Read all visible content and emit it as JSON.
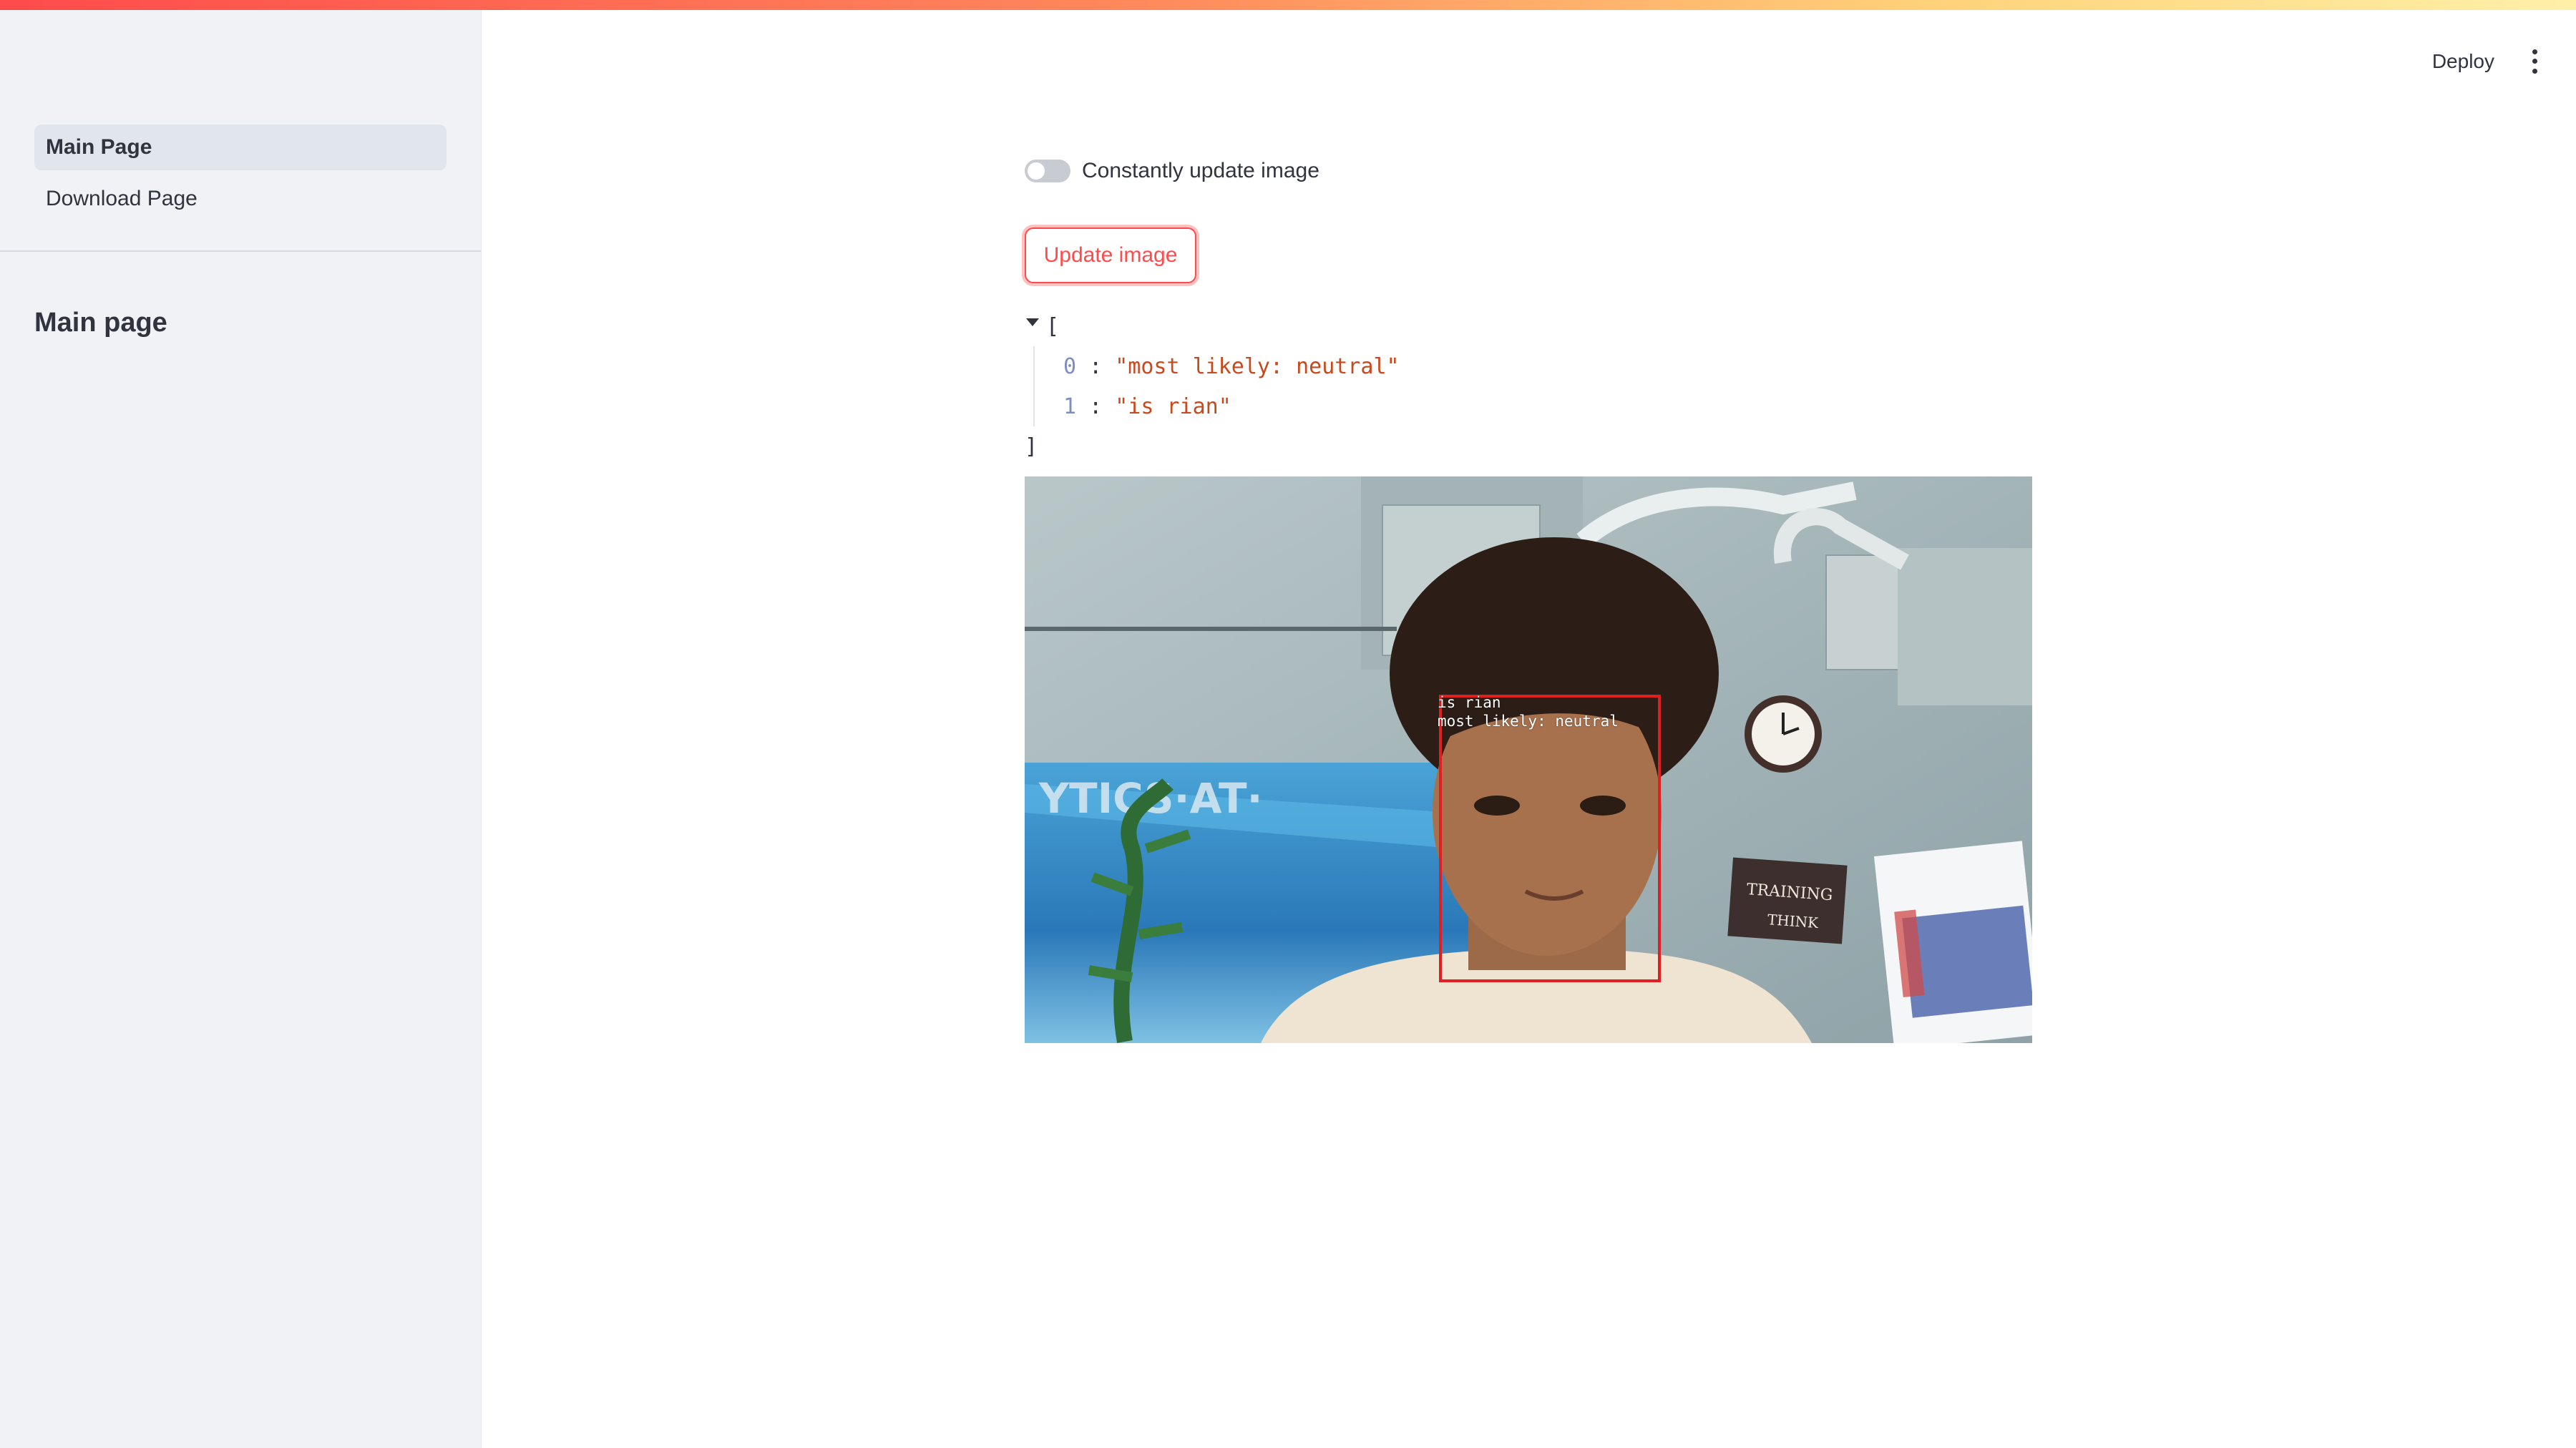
{
  "sidebar": {
    "nav_items": [
      {
        "label": "Main Page",
        "active": true
      },
      {
        "label": "Download Page",
        "active": false
      }
    ],
    "section_title": "Main page"
  },
  "header": {
    "deploy_label": "Deploy",
    "menu_icon": "kebab-menu-icon"
  },
  "main": {
    "toggle": {
      "label": "Constantly update image",
      "checked": false
    },
    "update_button_label": "Update image",
    "json_view": {
      "open_bracket": "[",
      "close_bracket": "]",
      "entries": [
        {
          "index": "0",
          "value": "\"most likely: neutral\""
        },
        {
          "index": "1",
          "value": "\"is rian\""
        }
      ]
    },
    "image": {
      "annotation_lines": [
        "is rian",
        "most likely: neutral"
      ]
    }
  },
  "colors": {
    "accent": "#ff4b4b",
    "sidebar_bg": "#f0f2f6",
    "json_string": "#c74a1f",
    "json_key": "#7e8fbf",
    "box_stroke": "#e02020"
  }
}
